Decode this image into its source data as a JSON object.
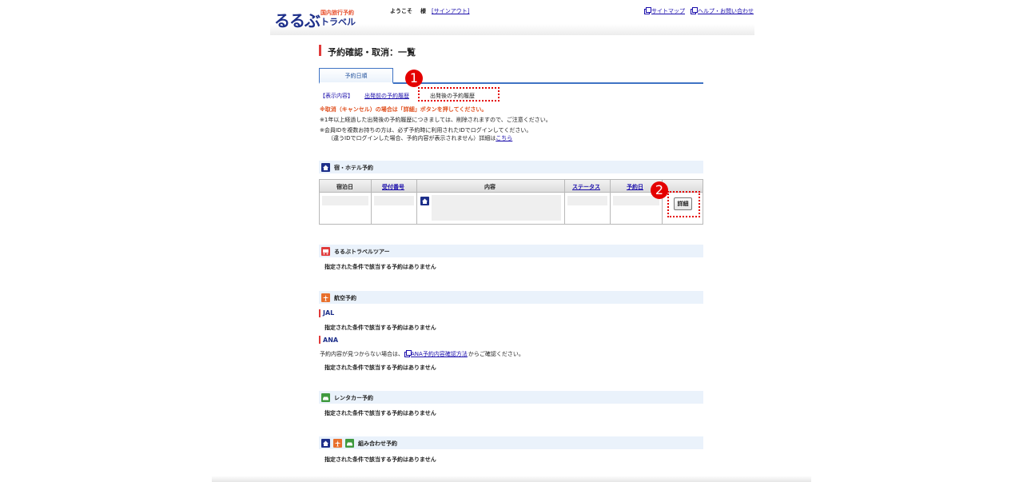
{
  "header": {
    "logo_main": "るるぶ",
    "logo_sub_top": "国内旅行予約",
    "logo_sub_bottom": "トラベル",
    "welcome": "ようこそ",
    "honorific": "様",
    "signout": "[サインアウト]",
    "sitemap": "サイトマップ",
    "help": "ヘルプ・お問い合わせ"
  },
  "page": {
    "title": "予約確認・取消：一覧"
  },
  "tabs": [
    {
      "label": "予約日順"
    }
  ],
  "filters": {
    "label": "【表示内容】",
    "past": "出発前の予約履歴",
    "after": "出発後の予約履歴"
  },
  "annotations": {
    "badge_1": "1",
    "badge_2": "2"
  },
  "notes": {
    "red": "※取消（キャンセル）の場合は「詳細」ボタンを押してください。",
    "line1": "※1年以上経過した出発後の予約履歴につきましては、削除されますので、ご注意ください。",
    "line2": "※会員IDを複数お持ちの方は、必ず予約時に利用されたIDでログインしてください。",
    "line3_prefix": "（違うIDでログインした場合、予約内容が表示されません）詳細は",
    "line3_link": "こちら"
  },
  "sections": {
    "hotel": {
      "label": "宿・ホテル予約",
      "icon": "house-icon",
      "color": "#1d2f8a"
    },
    "tour": {
      "label": "るるぶトラベルツアー",
      "icon": "bus-icon",
      "color": "#e03b3b"
    },
    "air": {
      "label": "航空予約",
      "icon": "plane-icon",
      "color": "#e8702d"
    },
    "car": {
      "label": "レンタカー予約",
      "icon": "car-icon",
      "color": "#3f9a3f"
    },
    "combo": {
      "label": "組み合わせ予約"
    }
  },
  "table": {
    "headers": [
      "宿泊日",
      "受付番号",
      "内容",
      "ステータス",
      "予約日"
    ],
    "detail_button": "詳細"
  },
  "empty_message": "指定された条件で該当する予約はありません",
  "air": {
    "jal": "JAL",
    "ana": "ANA",
    "ana_note_prefix": "予約内容が見つからない場合は、",
    "ana_link": "ANA予約内容確認方法",
    "ana_note_suffix": "からご確認ください。"
  }
}
